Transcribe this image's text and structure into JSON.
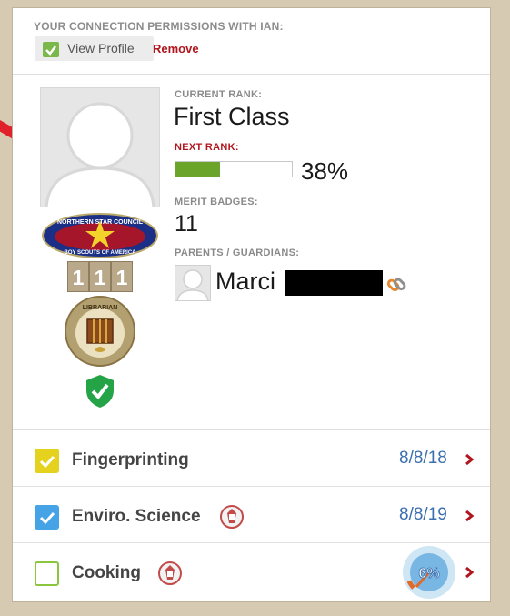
{
  "permissions": {
    "title": "YOUR CONNECTION PERMISSIONS WITH IAN:",
    "view_profile": "View Profile",
    "remove": "Remove"
  },
  "badges_column": {
    "council": {
      "line1": "NORTHERN STAR COUNCIL",
      "line2": "BOY SCOUTS OF AMERICA"
    },
    "unit_numbers": [
      "1",
      "1",
      "1"
    ],
    "merit_badge_label": "LIBRARIAN"
  },
  "profile": {
    "current_rank_label": "CURRENT RANK:",
    "current_rank": "First Class",
    "next_rank_label": "NEXT RANK:",
    "next_rank_progress": 0.38,
    "next_rank_percent": "38%",
    "merit_badges_label": "MERIT BADGES:",
    "merit_badges_count": "11",
    "parents_label": "PARENTS / GUARDIANS:",
    "parent_name": "Marci"
  },
  "requirements": [
    {
      "name": "Fingerprinting",
      "date": "8/8/18",
      "check_color": "#e5d21e",
      "checked": true,
      "eagle": false
    },
    {
      "name": "Enviro. Science",
      "date": "8/8/19",
      "check_color": "#45a3e6",
      "checked": true,
      "eagle": true
    },
    {
      "name": "Cooking",
      "percent": "6%",
      "progress": 0.06,
      "check_color": "#8cc63e",
      "checked": false,
      "eagle": true
    }
  ],
  "colors": {
    "accent_red": "#b0161e",
    "link_blue": "#3a6fb0",
    "progress_green": "#6aa52a"
  }
}
